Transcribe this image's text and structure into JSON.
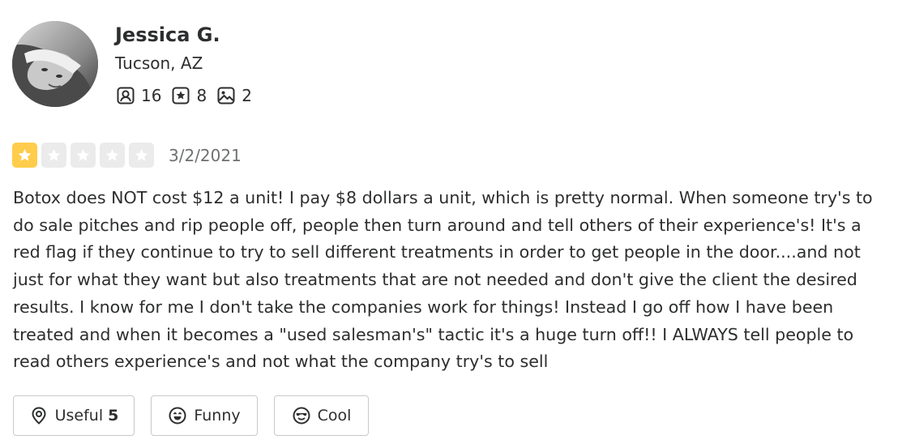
{
  "user": {
    "name": "Jessica G.",
    "location": "Tucson, AZ",
    "friends_count": "16",
    "reviews_count": "8",
    "photos_count": "2"
  },
  "review": {
    "rating_stars": 1,
    "rating_max": 5,
    "date": "3/2/2021",
    "text": "Botox does NOT cost $12 a unit! I pay $8 dollars a unit, which is pretty normal. When someone try's to do sale pitches and rip people off, people then turn around and tell others of their experience's! It's a red flag if they continue to try to sell different treatments in order to get people in the door....and not just for what they want but also treatments that are not needed and don't give the client the desired results. I know for me I don't take the companies work for things! Instead I go off how I have been treated and when it becomes a \"used salesman's\" tactic it's a huge turn off!! I ALWAYS tell people to read others experience's and not what the company try's to sell"
  },
  "actions": {
    "useful_label": "Useful",
    "useful_count": "5",
    "funny_label": "Funny",
    "cool_label": "Cool"
  },
  "colors": {
    "star_filled": "#ffcc4b",
    "star_empty": "#ebebeb",
    "text": "#2d2e2f",
    "muted": "#6e7072",
    "border": "#c8c9ca"
  },
  "icons": {
    "friends": "friends-icon",
    "reviews": "review-star-icon",
    "photos": "photo-icon",
    "useful": "useful-icon",
    "funny": "funny-face-icon",
    "cool": "cool-face-icon"
  }
}
